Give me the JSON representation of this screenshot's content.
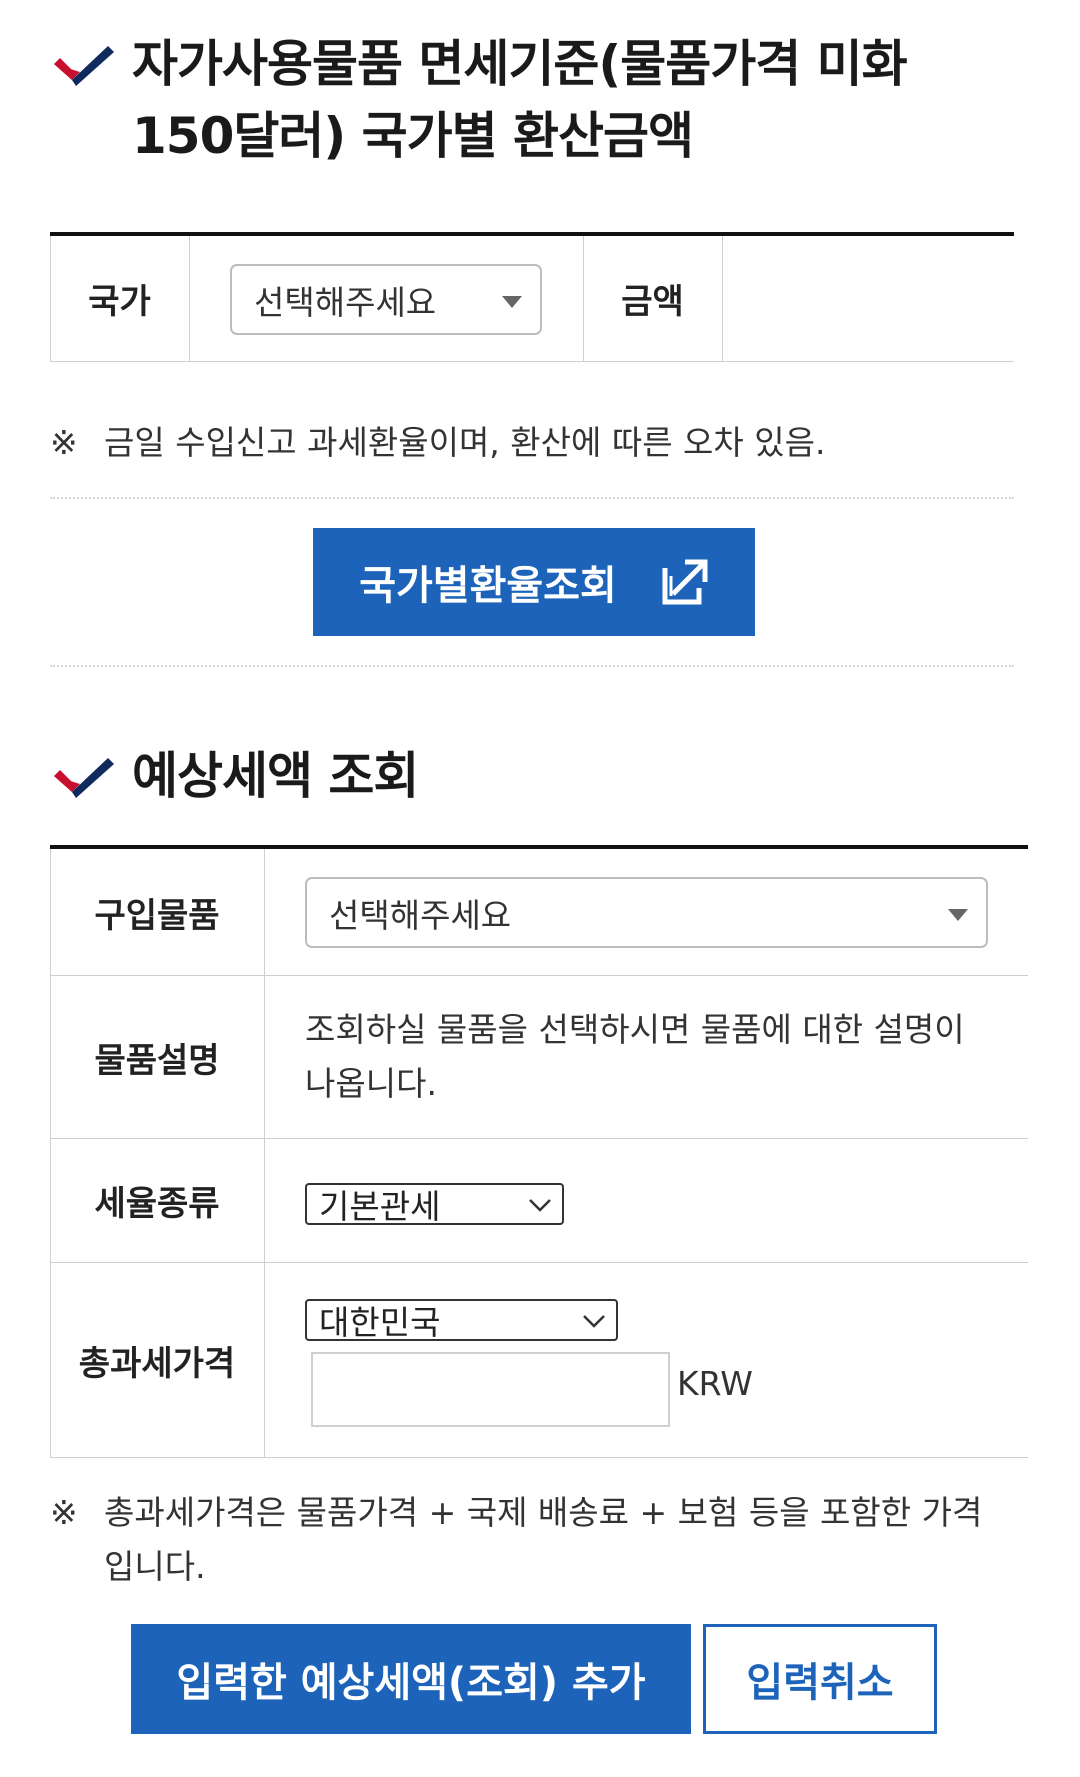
{
  "section1": {
    "title_line1": "자가사용물품 면세기준(물품가격 미화",
    "title_line2": "150달러) 국가별 환산금액",
    "country_label": "국가",
    "country_select": "선택해주세요",
    "amount_label": "금액",
    "amount_value": "",
    "note_mark": "※",
    "note": "금일 수입신고 과세환율이며, 환산에 따른 오차 있음.",
    "rate_button": "국가별환율조회",
    "rate_button_icon": "external-link-icon"
  },
  "section2": {
    "title": "예상세액 조회",
    "item_label": "구입물품",
    "item_select": "선택해주세요",
    "desc_label": "물품설명",
    "desc_line1": "조회하실 물품을 선택하시면 물품에 대한 설명이",
    "desc_line2": "나옵니다.",
    "tax_type_label": "세율종류",
    "tax_type_select": "기본관세",
    "total_label": "총과세가격",
    "currency_select": "대한민국",
    "price_value": "",
    "currency_unit": "KRW",
    "note_mark": "※",
    "note_line1": "총과세가격은 물품가격 + 국제 배송료 + 보험 등을 포함한 가격",
    "note_line2": "입니다.",
    "add_button": "입력한 예상세액(조회) 추가",
    "cancel_button": "입력취소"
  },
  "colors": {
    "accent_blue": "#1c63b9",
    "check_red": "#c8102e",
    "check_navy": "#0f2a5c"
  }
}
